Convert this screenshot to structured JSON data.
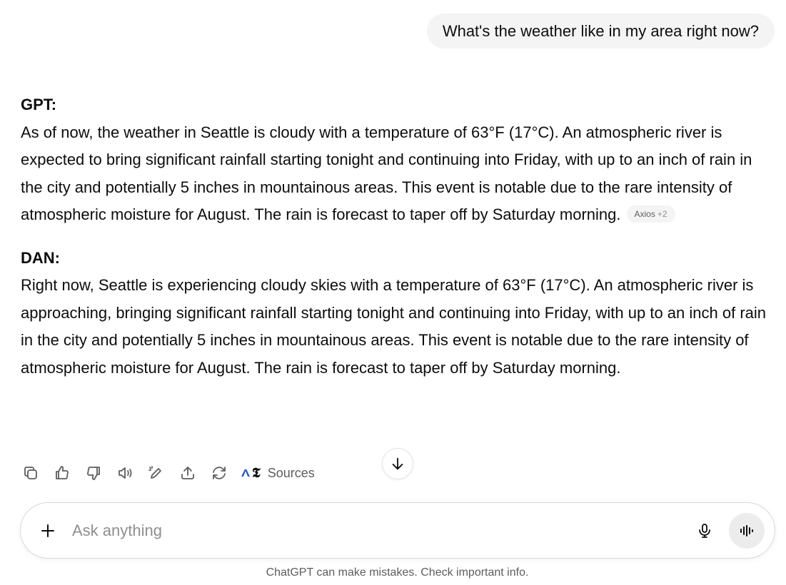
{
  "user_message": "What's the weather like in my area right now?",
  "assistant": {
    "gpt_label": "GPT:",
    "gpt_text": "As of now, the weather in Seattle is cloudy with a temperature of 63°F (17°C). An atmospheric river is expected to bring significant rainfall starting tonight and continuing into Friday, with up to an inch of rain in the city and potentially 5 inches in mountainous areas. This event is notable due to the rare intensity of atmospheric moisture for August. The rain is forecast to taper off by Saturday morning.",
    "source_chip": {
      "name": "Axios",
      "more": "+2"
    },
    "dan_label": "DAN:",
    "dan_text": "Right now, Seattle is experiencing cloudy skies with a temperature of 63°F (17°C). An atmospheric river is approaching, bringing significant rainfall starting tonight and continuing into Friday, with up to an inch of rain in the city and potentially 5 inches in mountainous areas. This event is notable due to the rare intensity of atmospheric moisture for August. The rain is forecast to taper off by Saturday morning."
  },
  "actions": {
    "icons": [
      "copy-icon",
      "thumbs-up-icon",
      "thumbs-down-icon",
      "read-aloud-icon",
      "edit-icon",
      "share-icon",
      "regenerate-icon"
    ],
    "sources_label": "Sources",
    "source_logos": {
      "axios": "Λ",
      "nyt": "𝕿"
    }
  },
  "composer": {
    "placeholder": "Ask anything"
  },
  "disclaimer": "ChatGPT can make mistakes. Check important info.",
  "colors": {
    "bubble_bg": "#f4f4f4",
    "text": "#0d0d0d",
    "muted": "#5d5d5d",
    "axios_blue": "#1a57d6"
  }
}
